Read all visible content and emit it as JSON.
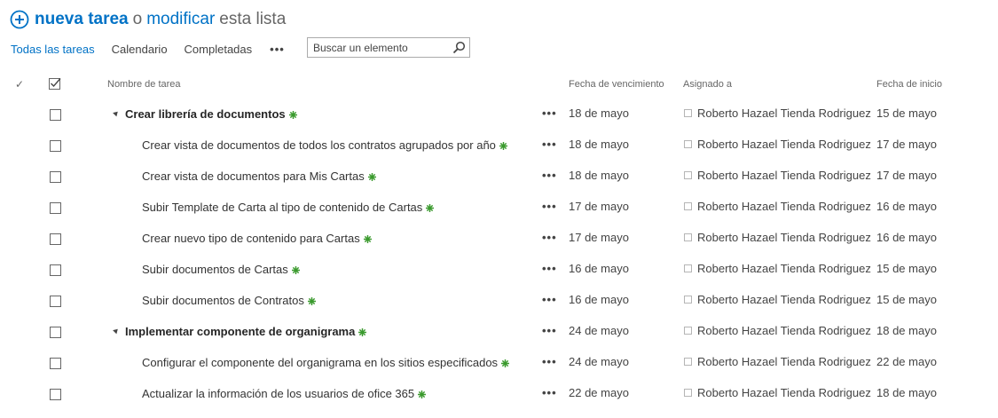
{
  "header": {
    "new_task": "nueva tarea",
    "or": "o",
    "modify": "modificar",
    "list": "esta lista"
  },
  "views": {
    "tabs": [
      "Todas las tareas",
      "Calendario",
      "Completadas"
    ],
    "more": "•••"
  },
  "search": {
    "placeholder": "Buscar un elemento"
  },
  "columns": {
    "check": "✓",
    "title": "Nombre de tarea",
    "due": "Fecha de vencimiento",
    "assigned": "Asignado a",
    "start": "Fecha de inicio"
  },
  "colors": {
    "accent": "#0072c6",
    "new_badge": "#3a9a2d"
  },
  "rows": [
    {
      "title": "Crear librería de documentos",
      "level": 0,
      "menu": "•••",
      "due": "18 de mayo",
      "assigned": "Roberto Hazael Tienda Rodriguez",
      "start": "15 de mayo"
    },
    {
      "title": "Crear vista de documentos de todos los contratos agrupados por año",
      "level": 1,
      "menu": "•••",
      "due": "18 de mayo",
      "assigned": "Roberto Hazael Tienda Rodriguez",
      "start": "17 de mayo"
    },
    {
      "title": "Crear vista de documentos para Mis Cartas",
      "level": 1,
      "menu": "•••",
      "due": "18 de mayo",
      "assigned": "Roberto Hazael Tienda Rodriguez",
      "start": "17 de mayo"
    },
    {
      "title": "Subir Template de Carta al tipo de contenido de Cartas",
      "level": 1,
      "menu": "•••",
      "due": "17 de mayo",
      "assigned": "Roberto Hazael Tienda Rodriguez",
      "start": "16 de mayo"
    },
    {
      "title": "Crear nuevo tipo de contenido para Cartas",
      "level": 1,
      "menu": "•••",
      "due": "17 de mayo",
      "assigned": "Roberto Hazael Tienda Rodriguez",
      "start": "16 de mayo"
    },
    {
      "title": "Subir documentos de Cartas",
      "level": 1,
      "menu": "•••",
      "due": "16 de mayo",
      "assigned": "Roberto Hazael Tienda Rodriguez",
      "start": "15 de mayo"
    },
    {
      "title": "Subir documentos de Contratos",
      "level": 1,
      "menu": "•••",
      "due": "16 de mayo",
      "assigned": "Roberto Hazael Tienda Rodriguez",
      "start": "15 de mayo"
    },
    {
      "title": "Implementar componente de organigrama",
      "level": 0,
      "menu": "•••",
      "due": "24 de mayo",
      "assigned": "Roberto Hazael Tienda Rodriguez",
      "start": "18 de mayo"
    },
    {
      "title": "Configurar el componente del organigrama en los sitios especificados",
      "level": 1,
      "menu": "•••",
      "due": "24 de mayo",
      "assigned": "Roberto Hazael Tienda Rodriguez",
      "start": "22 de mayo"
    },
    {
      "title": "Actualizar la información de los usuarios de ofice 365",
      "level": 1,
      "menu": "•••",
      "due": "22 de mayo",
      "assigned": "Roberto Hazael Tienda Rodriguez",
      "start": "18 de mayo"
    }
  ]
}
